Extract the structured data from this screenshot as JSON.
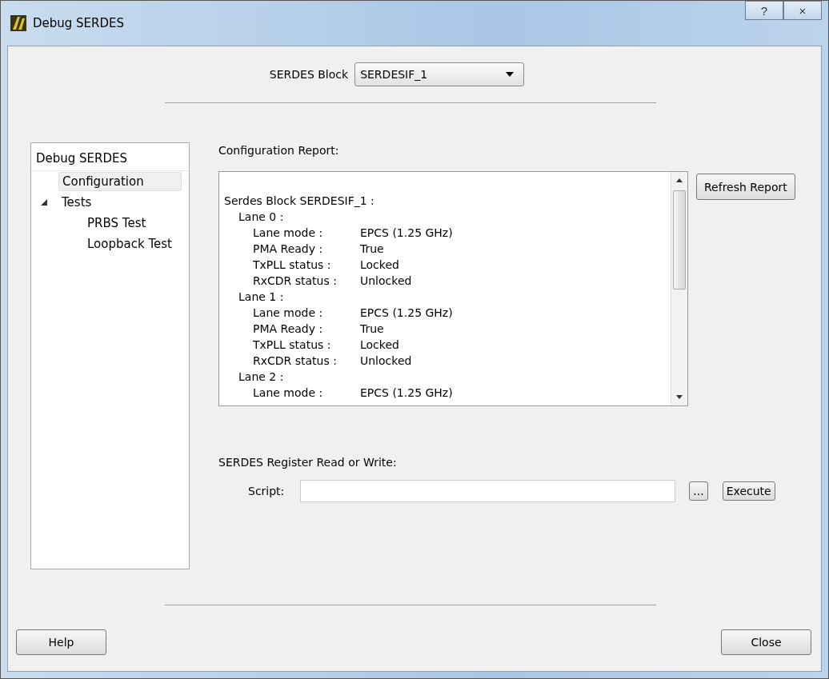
{
  "window": {
    "title": "Debug SERDES",
    "help_button": "?",
    "close_button": "×"
  },
  "serdes_block": {
    "label": "SERDES Block",
    "value": "SERDESIF_1"
  },
  "tree": {
    "header": "Debug SERDES",
    "items": [
      {
        "label": "Configuration",
        "selected": true
      },
      {
        "label": "Tests",
        "selected": false,
        "expanded": true,
        "children": [
          {
            "label": "PRBS Test",
            "selected": false
          },
          {
            "label": "Loopback Test",
            "selected": false
          }
        ]
      }
    ]
  },
  "report": {
    "label": "Configuration Report:",
    "heading": "Serdes Block SERDESIF_1 :",
    "lanes": [
      {
        "label": "Lane 0 :",
        "fields": [
          {
            "label": "Lane mode :",
            "value": "EPCS (1.25 GHz)"
          },
          {
            "label": "PMA Ready :",
            "value": "True"
          },
          {
            "label": "TxPLL status :",
            "value": "Locked"
          },
          {
            "label": "RxCDR status :",
            "value": "Unlocked"
          }
        ]
      },
      {
        "label": "Lane 1 :",
        "fields": [
          {
            "label": "Lane mode :",
            "value": "EPCS (1.25 GHz)"
          },
          {
            "label": "PMA Ready :",
            "value": "True"
          },
          {
            "label": "TxPLL status :",
            "value": "Locked"
          },
          {
            "label": "RxCDR status :",
            "value": "Unlocked"
          }
        ]
      },
      {
        "label": "Lane 2 :",
        "fields": [
          {
            "label": "Lane mode :",
            "value": "EPCS (1.25 GHz)"
          }
        ]
      }
    ],
    "refresh_button": "Refresh Report"
  },
  "register": {
    "label": "SERDES Register Read or Write:",
    "script_label": "Script:",
    "browse_button": "...",
    "execute_button": "Execute"
  },
  "buttons": {
    "help": "Help",
    "close": "Close"
  }
}
